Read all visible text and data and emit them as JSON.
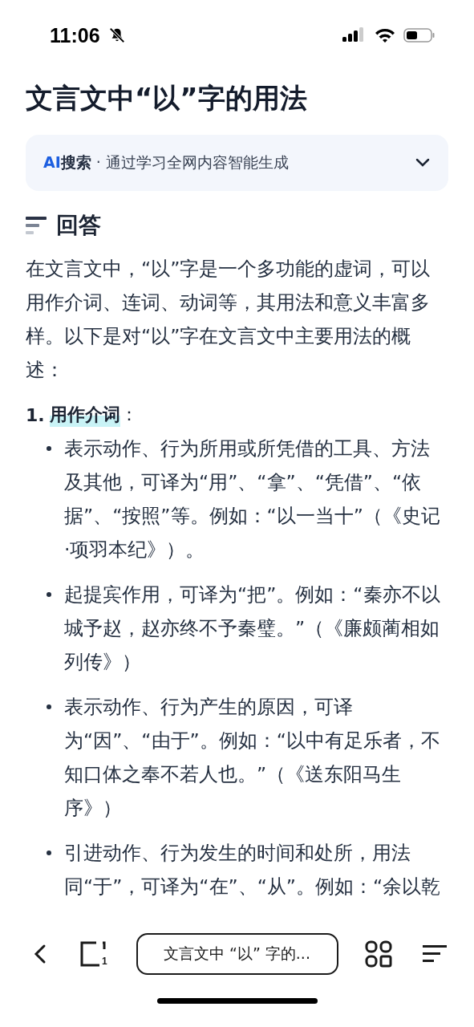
{
  "status_bar": {
    "time": "11:06",
    "muted": true
  },
  "title": "文言文中“以”字的用法",
  "ai_banner": {
    "badge_strong": "AI",
    "badge_rest": "搜索",
    "separator": "·",
    "text": "通过学习全网内容智能生成",
    "expanded": false
  },
  "answer": {
    "heading": "回答",
    "intro": "在文言文中，“以”字是一个多功能的虚词，可以用作介词、连词、动词等，其用法和意义丰富多样。以下是对“以”字在文言文中主要用法的概述：",
    "sections": [
      {
        "number": "1.",
        "heading": "用作介词",
        "highlighted": true,
        "suffix": "：",
        "bullets": [
          "表示动作、行为所用或所凭借的工具、方法及其他，可译为“用”、“拿”、“凭借”、“依据”、“按照”等。例如：“以一当十”（《史记·项羽本纪》）。",
          "起提宾作用，可译为“把”。例如：“秦亦不以城予赵，赵亦终不予秦璧。”（《廉颇蔺相如列传》）",
          "表示动作、行为产生的原因，可译为“因”、“由于”。例如：“以中有足乐者，不知口体之奉不若人也。”（《送东阳马生序》）",
          "引进动作、行为发生的时间和处所，用法同“于”，可译为“在”、“从”。例如：“余以乾"
        ]
      }
    ]
  },
  "bottom_bar": {
    "tab_count": "1",
    "address": "文言文中 “以” 字的..."
  }
}
